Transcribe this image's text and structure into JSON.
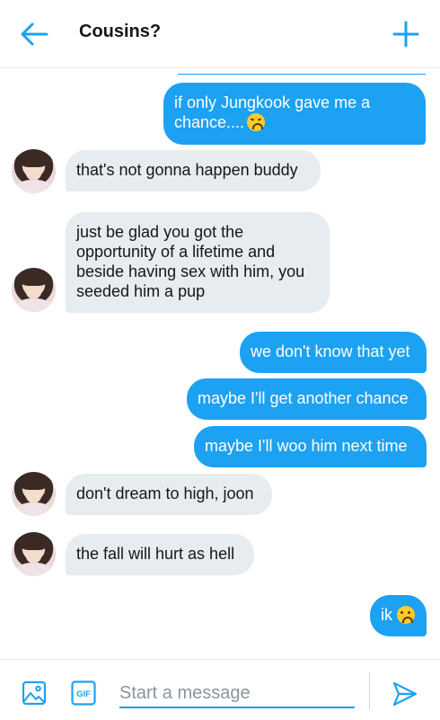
{
  "header": {
    "title": "Cousins?",
    "back_icon": "arrow-left-icon",
    "new_icon": "plus-icon"
  },
  "colors": {
    "accent": "#1da1f2",
    "received_bubble": "#e6ecf0",
    "text_dark": "#14171a"
  },
  "messages": [
    {
      "from": "me",
      "text": "if only Jungkook gave me a chance....",
      "emoji": "weary-face"
    },
    {
      "from": "them",
      "text": "that's not gonna happen buddy"
    },
    {
      "from": "them",
      "text": "just be glad you got the opportunity of a lifetime and beside having sex with him, you seeded him a pup"
    },
    {
      "from": "me",
      "text": "we don't know that yet"
    },
    {
      "from": "me",
      "text": "maybe I'll get another chance"
    },
    {
      "from": "me",
      "text": "maybe I'll woo him next time"
    },
    {
      "from": "them",
      "text": "don't dream to high, joon"
    },
    {
      "from": "them",
      "text": "the fall will hurt as hell"
    },
    {
      "from": "me",
      "text": "ik",
      "emoji": "frowning-face"
    }
  ],
  "composer": {
    "placeholder": "Start a message",
    "value": "",
    "gif_label": "GIF",
    "image_icon": "image-icon",
    "send_icon": "send-icon"
  }
}
